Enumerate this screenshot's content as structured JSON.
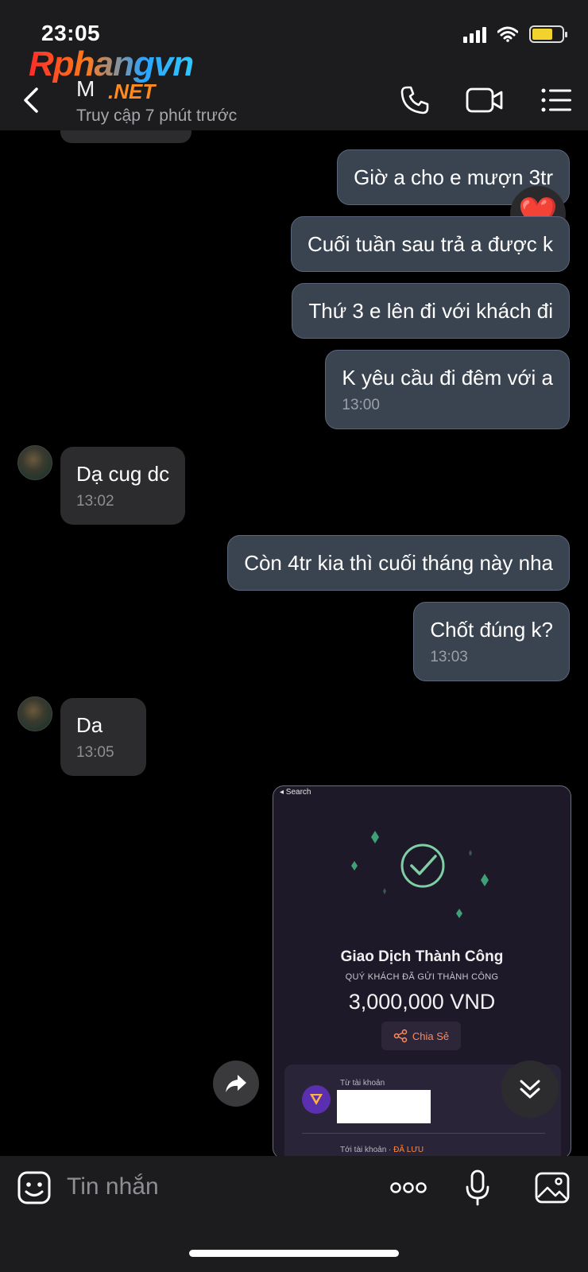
{
  "status_bar": {
    "time": "23:05"
  },
  "watermark": {
    "brand": "Rphangvn",
    "suffix": ".NET"
  },
  "header": {
    "contact_name": "M",
    "contact_status": "Truy cập 7 phút trước"
  },
  "messages": [
    {
      "dir": "out",
      "text": "Giờ a cho e mượn 3tr",
      "time": ""
    },
    {
      "dir": "out",
      "text": "Cuối tuần sau trả a được k",
      "time": ""
    },
    {
      "dir": "out",
      "text": "Thứ 3 e lên đi với khách đi",
      "time": ""
    },
    {
      "dir": "out",
      "text": "K yêu cầu đi đêm với a",
      "time": "13:00"
    },
    {
      "dir": "in",
      "text": "Dạ cug dc",
      "time": "13:02"
    },
    {
      "dir": "out",
      "text": "Còn 4tr kia thì cuối tháng này nha",
      "time": ""
    },
    {
      "dir": "out",
      "text": "Chốt đúng k?",
      "time": "13:03"
    },
    {
      "dir": "in",
      "text": "Da",
      "time": "13:05"
    }
  ],
  "reaction": {
    "emoji": "❤️"
  },
  "receipt": {
    "search_label": "◂ Search",
    "title": "Giao Dịch Thành Công",
    "subtitle": "QUÝ KHÁCH ĐÃ GỬI THÀNH CÔNG",
    "amount": "3,000,000 VND",
    "share_label": "Chia Sẻ",
    "from_label": "Từ tài khoản",
    "to_label": "Tới tài khoản",
    "to_saved": "ĐÃ LƯU"
  },
  "composer": {
    "placeholder": "Tin nhắn"
  },
  "colors": {
    "outgoing_bubble": "#3a4350",
    "incoming_bubble": "#2c2c2e",
    "accent_success": "#7fcfa6"
  }
}
